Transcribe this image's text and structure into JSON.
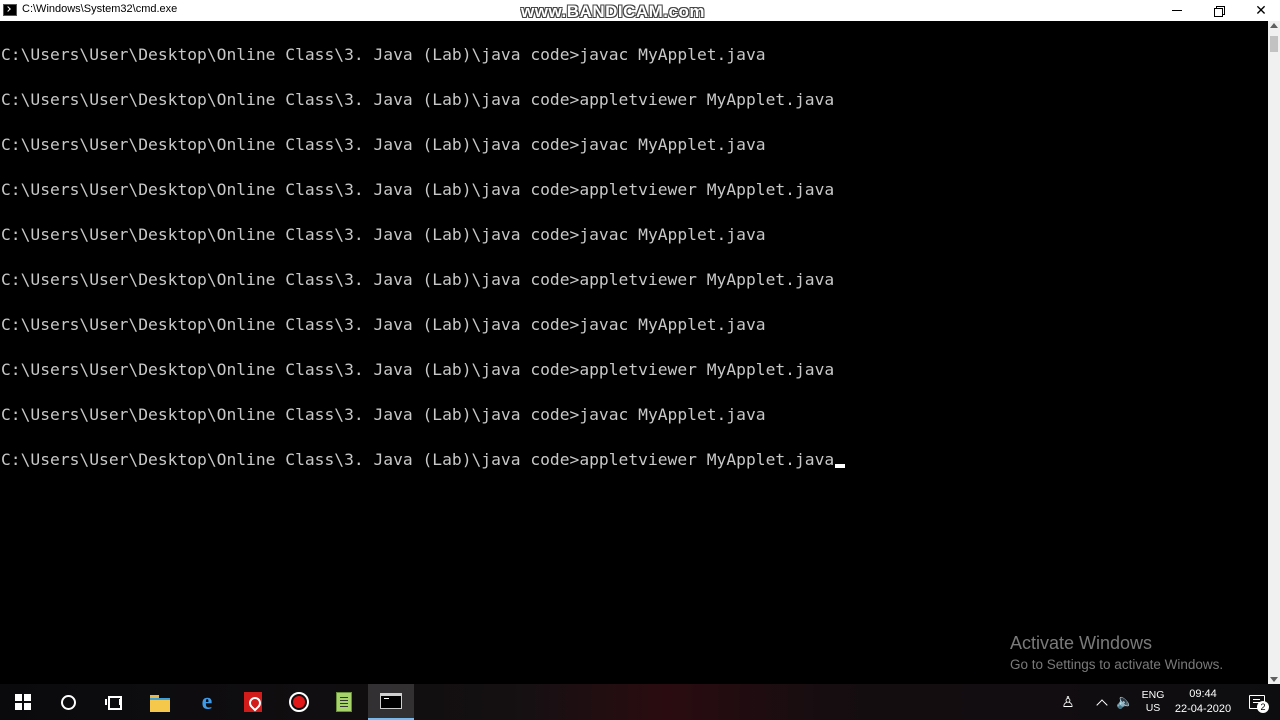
{
  "window": {
    "title": "C:\\Windows\\System32\\cmd.exe",
    "watermark": "www.BANDICAM.com"
  },
  "console": {
    "lines": [
      "C:\\Users\\User\\Desktop\\Online Class\\3. Java (Lab)\\java code>javac MyApplet.java",
      "C:\\Users\\User\\Desktop\\Online Class\\3. Java (Lab)\\java code>appletviewer MyApplet.java",
      "C:\\Users\\User\\Desktop\\Online Class\\3. Java (Lab)\\java code>javac MyApplet.java",
      "C:\\Users\\User\\Desktop\\Online Class\\3. Java (Lab)\\java code>appletviewer MyApplet.java",
      "C:\\Users\\User\\Desktop\\Online Class\\3. Java (Lab)\\java code>javac MyApplet.java",
      "C:\\Users\\User\\Desktop\\Online Class\\3. Java (Lab)\\java code>appletviewer MyApplet.java",
      "C:\\Users\\User\\Desktop\\Online Class\\3. Java (Lab)\\java code>javac MyApplet.java",
      "C:\\Users\\User\\Desktop\\Online Class\\3. Java (Lab)\\java code>appletviewer MyApplet.java",
      "C:\\Users\\User\\Desktop\\Online Class\\3. Java (Lab)\\java code>javac MyApplet.java",
      "C:\\Users\\User\\Desktop\\Online Class\\3. Java (Lab)\\java code>appletviewer MyApplet.java"
    ]
  },
  "activation": {
    "title": "Activate Windows",
    "subtitle": "Go to Settings to activate Windows."
  },
  "taskbar": {
    "items": [
      {
        "name": "start-button-icon"
      },
      {
        "name": "search-icon"
      },
      {
        "name": "task-view-icon"
      },
      {
        "name": "file-explorer-icon"
      },
      {
        "name": "internet-explorer-icon"
      },
      {
        "name": "adobe-reader-icon"
      },
      {
        "name": "bandicam-record-icon"
      },
      {
        "name": "notepad-icon"
      },
      {
        "name": "command-prompt-icon",
        "active": true
      }
    ],
    "tray": {
      "lang_top": "ENG",
      "lang_bottom": "US",
      "time": "09:44",
      "date": "22-04-2020",
      "notification_count": "2"
    }
  },
  "colors": {
    "console_bg": "#000000",
    "console_text": "#c8c8c8",
    "titlebar_bg": "#ffffff",
    "taskbar_active_accent": "#76b9ed"
  }
}
